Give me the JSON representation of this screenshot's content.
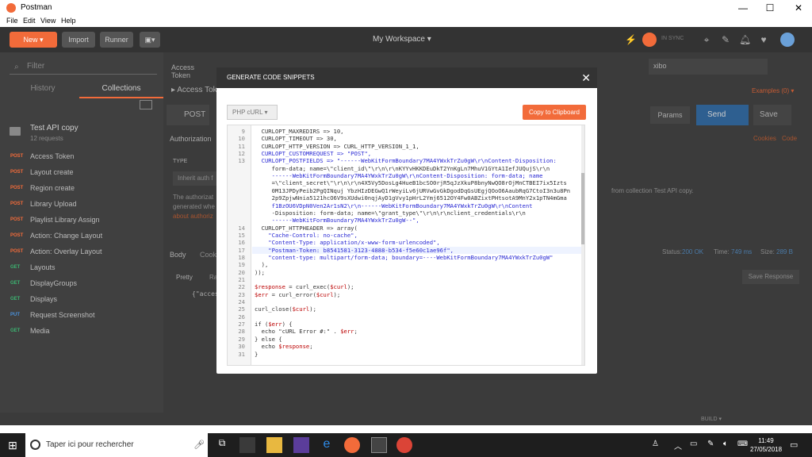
{
  "window": {
    "title": "Postman"
  },
  "menu": [
    "File",
    "Edit",
    "View",
    "Help"
  ],
  "toolbar": {
    "new": "New",
    "import": "Import",
    "runner": "Runner",
    "workspace": "My Workspace ▾",
    "sync": "IN SYNC"
  },
  "sidebar": {
    "filter_placeholder": "Filter",
    "tabs": [
      "History",
      "Collections"
    ],
    "collection": {
      "name": "Test API copy",
      "count": "12 requests"
    },
    "requests": [
      {
        "method": "POST",
        "label": "Access Token",
        "color": "#f26b3a"
      },
      {
        "method": "POST",
        "label": "Layout create",
        "color": "#f26b3a"
      },
      {
        "method": "POST",
        "label": "Region create",
        "color": "#f26b3a"
      },
      {
        "method": "POST",
        "label": "Library Upload",
        "color": "#f26b3a"
      },
      {
        "method": "POST",
        "label": "Playlist Library Assign",
        "color": "#f26b3a"
      },
      {
        "method": "POST",
        "label": "Action: Change Layout",
        "color": "#f26b3a"
      },
      {
        "method": "POST",
        "label": "Action: Overlay Layout",
        "color": "#f26b3a"
      },
      {
        "method": "GET",
        "label": "Layouts",
        "color": "#3cb371"
      },
      {
        "method": "GET",
        "label": "DisplayGroups",
        "color": "#3cb371"
      },
      {
        "method": "GET",
        "label": "Displays",
        "color": "#3cb371"
      },
      {
        "method": "PUT",
        "label": "Request Screenshot",
        "color": "#4a90d9"
      },
      {
        "method": "GET",
        "label": "Media",
        "color": "#3cb371"
      }
    ]
  },
  "main": {
    "tab": "Access Token",
    "breadcrumb": "▸ Access Token",
    "method": "POST",
    "env": "xibo",
    "examples": "Examples (0) ▾",
    "params": "Params",
    "send": "Send",
    "save": "Save",
    "authorization": "Authorization",
    "cookies": "Cookies",
    "code": "Code",
    "type_label": "TYPE",
    "type_value": "Inherit auth f",
    "auth_text1": "The authorizat",
    "auth_text2": "generated whe",
    "auth_text3": "about authoriz",
    "from_collection": "from collection Test API copy.",
    "body_tab": "Body",
    "cookies_tab": "Cook",
    "pretty": "Pretty",
    "raw": "Ra",
    "status_label": "Status:",
    "status_value": "200 OK",
    "time_label": "Time:",
    "time_value": "749 ms",
    "size_label": "Size:",
    "size_value": "289 B",
    "save_response": "Save Response",
    "response_preview": "{\"acces",
    "build": "BUILD ▾"
  },
  "modal": {
    "title": "GENERATE CODE SNIPPETS",
    "language": "PHP cURL ▾",
    "copy": "Copy to Clipboard",
    "lines": [
      {
        "n": "9",
        "t": "  CURLOPT_MAXREDIRS => 10,"
      },
      {
        "n": "10",
        "t": "  CURLOPT_TIMEOUT => 30,"
      },
      {
        "n": "11",
        "t": "  CURLOPT_HTTP_VERSION => CURL_HTTP_VERSION_1_1,"
      },
      {
        "n": "12",
        "t": "  CURLOPT_CUSTOMREQUEST => \"POST\","
      },
      {
        "n": "13",
        "t": "  CURLOPT_POSTFIELDS => \"------WebKitFormBoundary7MA4YWxkTrZu0gW\\r\\nContent-Disposition:"
      },
      {
        "n": "",
        "t": "     form-data; name=\\\"client_id\\\"\\r\\n\\r\\nKYYvHKKDEuDkT2YnKgLn7MhuV1GYtA1IefJUQujS\\r\\n"
      },
      {
        "n": "",
        "t": "     ------WebKitFormBoundary7MA4YWxkTrZu0gW\\r\\nContent-Disposition: form-data; name"
      },
      {
        "n": "",
        "t": "     =\\\"client_secret\\\"\\r\\n\\r\\n4X5Vy5DosLg4HueB1bcSO0rjR5qJzXkuP8bnyNwQO8rOjMnCTBEI7ix5Izts"
      },
      {
        "n": "",
        "t": "     0M13JPDyPeib2PgQINquj YbzHIzDEGwQ1rWeyiLv6jURVwGvGkDgodDqGsUEgjQOoO6AaubRqG7CtoI3n3u8Pn"
      },
      {
        "n": "",
        "t": "     2p9ZpjwNnia5121hcO6V9sXUdwi0nqjAyD1gVvy1pHrL2Ymj6512OY4Fw0ABZixtPHtsotA9MnY2x1pTN4mGma"
      },
      {
        "n": "",
        "t": "     f1BzOU6VDpN0Ven2Ar1sN2\\r\\n------WebKitFormBoundary7MA4YWxkTrZu0gW\\r\\nContent"
      },
      {
        "n": "",
        "t": "     -Disposition: form-data; name=\\\"grant_type\\\"\\r\\n\\r\\nclient_credentials\\r\\n"
      },
      {
        "n": "",
        "t": "     ------WebKitFormBoundary7MA4YWxkTrZu0gW--\","
      },
      {
        "n": "14",
        "t": "  CURLOPT_HTTPHEADER => array("
      },
      {
        "n": "15",
        "t": "    \"Cache-Control: no-cache\","
      },
      {
        "n": "16",
        "t": "    \"Content-Type: application/x-www-form-urlencoded\","
      },
      {
        "n": "17",
        "t": "    \"Postman-Token: b8541581-3123-4888-b534-f5e60c1ae96f\","
      },
      {
        "n": "18",
        "t": "    \"content-type: multipart/form-data; boundary=----WebKitFormBoundary7MA4YWxkTrZu0gW\""
      },
      {
        "n": "19",
        "t": "  ),"
      },
      {
        "n": "20",
        "t": "));"
      },
      {
        "n": "21",
        "t": ""
      },
      {
        "n": "22",
        "t": "$response = curl_exec($curl);"
      },
      {
        "n": "23",
        "t": "$err = curl_error($curl);"
      },
      {
        "n": "24",
        "t": ""
      },
      {
        "n": "25",
        "t": "curl_close($curl);"
      },
      {
        "n": "26",
        "t": ""
      },
      {
        "n": "27",
        "t": "if ($err) {"
      },
      {
        "n": "28",
        "t": "  echo \"cURL Error #:\" . $err;"
      },
      {
        "n": "29",
        "t": "} else {"
      },
      {
        "n": "30",
        "t": "  echo $response;"
      },
      {
        "n": "31",
        "t": "}"
      }
    ]
  },
  "taskbar": {
    "search": "Taper ici pour rechercher",
    "time": "11:49",
    "date": "27/05/2018"
  }
}
